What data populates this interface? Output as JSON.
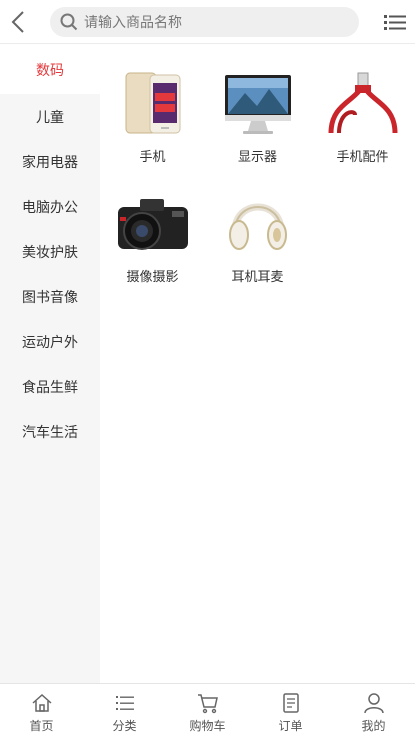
{
  "header": {
    "search_placeholder": "请输入商品名称"
  },
  "sidebar": {
    "items": [
      {
        "label": "数码",
        "active": true
      },
      {
        "label": "儿童"
      },
      {
        "label": "家用电器"
      },
      {
        "label": "电脑办公"
      },
      {
        "label": "美妆护肤"
      },
      {
        "label": "图书音像"
      },
      {
        "label": "运动户外"
      },
      {
        "label": "食品生鲜"
      },
      {
        "label": "汽车生活"
      }
    ]
  },
  "products": [
    {
      "label": "手机",
      "icon": "phone-image"
    },
    {
      "label": "显示器",
      "icon": "monitor-image"
    },
    {
      "label": "手机配件",
      "icon": "cable-image"
    },
    {
      "label": "摄像摄影",
      "icon": "camera-image"
    },
    {
      "label": "耳机耳麦",
      "icon": "headphones-image"
    }
  ],
  "tabbar": {
    "items": [
      {
        "label": "首页",
        "icon": "home-icon"
      },
      {
        "label": "分类",
        "icon": "list-icon"
      },
      {
        "label": "购物车",
        "icon": "cart-icon"
      },
      {
        "label": "订单",
        "icon": "order-icon"
      },
      {
        "label": "我的",
        "icon": "user-icon"
      }
    ]
  },
  "colors": {
    "accent": "#e4393c",
    "sidebar_bg": "#f6f6f6"
  }
}
